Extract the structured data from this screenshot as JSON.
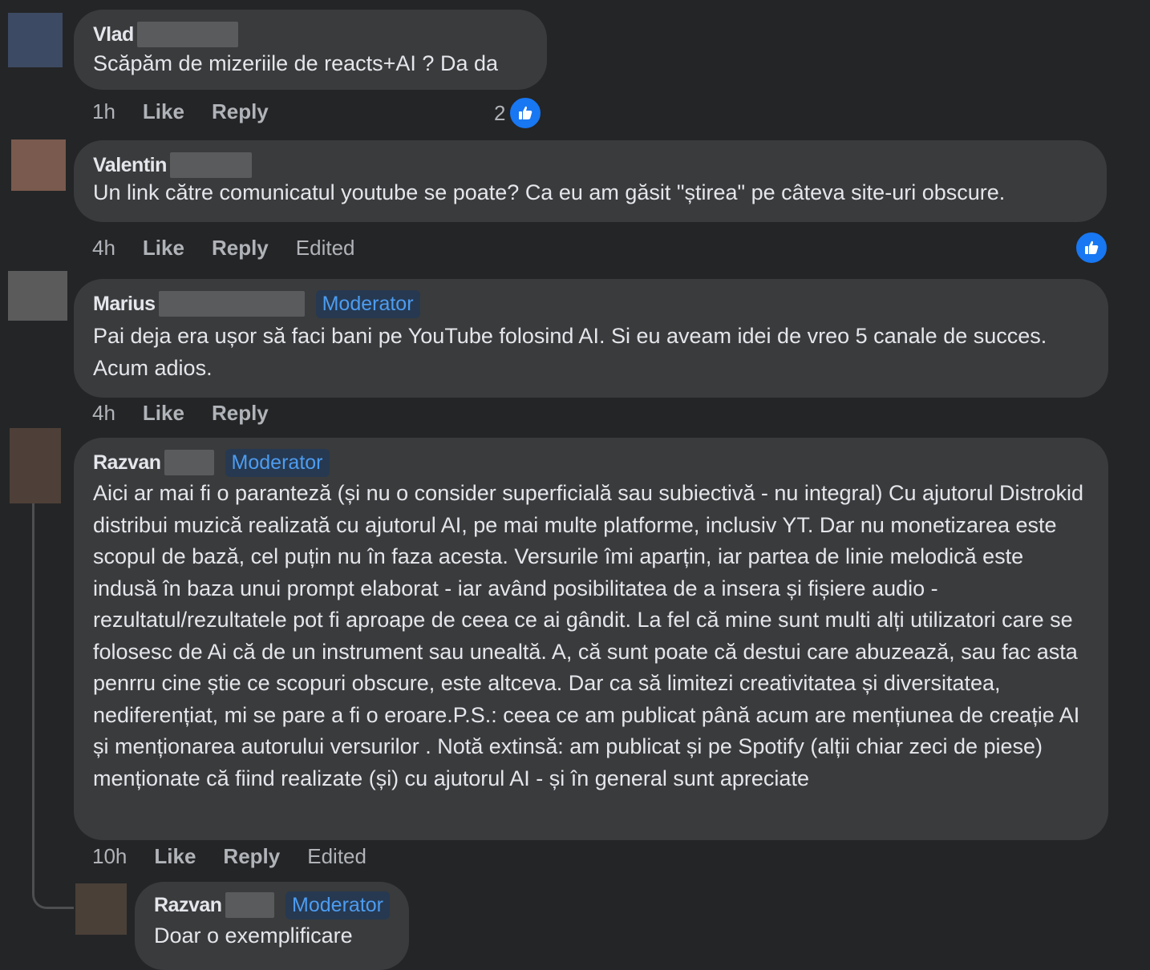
{
  "comments": [
    {
      "name": "Vlad",
      "badge": "",
      "text": "Scăpăm de mizeriile de reacts+AI ? Da da",
      "time": "1h",
      "like": "Like",
      "reply": "Reply",
      "edited": "",
      "reaction_count": "2",
      "avatar_color": "#3d4a63"
    },
    {
      "name": "Valentin",
      "badge": "",
      "text": "Un link către comunicatul youtube se poate? Ca eu am găsit \"știrea\" pe câteva site-uri obscure.",
      "time": "4h",
      "like": "Like",
      "reply": "Reply",
      "edited": "Edited",
      "reaction_count": "",
      "avatar_color": "#7a5a4e"
    },
    {
      "name": "Marius",
      "badge": "Moderator",
      "text": "Pai deja era ușor să faci bani pe YouTube folosind AI. Si eu aveam idei de vreo 5 canale de succes. Acum adios.",
      "time": "4h",
      "like": "Like",
      "reply": "Reply",
      "edited": "",
      "reaction_count": "",
      "avatar_color": "#5b5b5b"
    },
    {
      "name": "Razvan",
      "badge": "Moderator",
      "text": "Aici ar mai fi o paranteză (și nu o consider superficială sau subiectivă - nu integral) Cu ajutorul Distrokid distribui muzică realizată cu ajutorul AI, pe mai multe platforme, inclusiv YT. Dar nu monetizarea este scopul de bază, cel puțin nu în faza acesta. Versurile îmi aparțin, iar partea de linie melodică este indusă în baza unui prompt elaborat - iar având posibilitatea de a insera și fișiere audio - rezultatul/rezultatele pot fi aproape de ceea ce ai gândit. La fel că mine sunt multi alți utilizatori care se folosesc de Ai că de un instrument sau unealtă. A, că sunt poate că destui care abuzează, sau fac asta penrru cine știe ce scopuri obscure, este altceva. Dar ca să limitezi creativitatea și diversitatea, nediferențiat, mi se pare a fi o eroare.P.S.: ceea ce am publicat până acum are mențiunea de creație AI și menționarea autorului versurilor . Notă extinsă: am publicat și pe Spotify (alții chiar zeci de piese) menționate că fiind realizate (și) cu ajutorul AI - și în general sunt apreciate",
      "time": "10h",
      "like": "Like",
      "reply": "Reply",
      "edited": "Edited",
      "reaction_count": "",
      "avatar_color": "#4e4038"
    }
  ],
  "reply": {
    "name": "Razvan",
    "badge": "Moderator",
    "text": "Doar o exemplificare",
    "avatar_color": "#4a4038"
  },
  "colors": {
    "background": "#242526",
    "bubble": "#3a3b3c",
    "accent": "#1877f2",
    "badge_text": "#4d9cf0"
  },
  "icons": [
    "like-reaction-icon"
  ]
}
